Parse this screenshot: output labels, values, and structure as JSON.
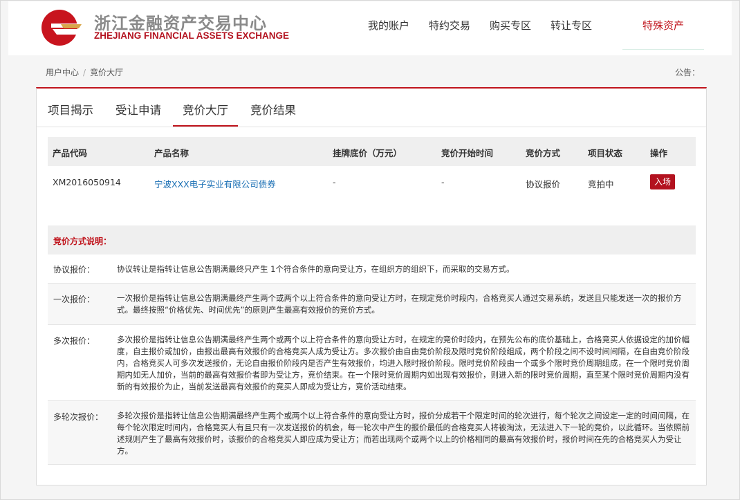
{
  "header": {
    "logo_cn": "浙江金融资产交易中心",
    "logo_en": "ZHEJIANG FINANCIAL ASSETS EXCHANGE",
    "nav": [
      "我的账户",
      "特约交易",
      "购买专区",
      "转让专区"
    ],
    "nav_special": "特殊资产"
  },
  "breadcrumb": {
    "home": "用户中心",
    "sep": "/",
    "current": "竞价大厅"
  },
  "notice": "公告：",
  "tabs": [
    "项目揭示",
    "受让申请",
    "竞价大厅",
    "竞价结果"
  ],
  "table": {
    "headers": [
      "产品代码",
      "产品名称",
      "挂牌底价（万元）",
      "竞价开始时间",
      "竞价方式",
      "项目状态",
      "操作"
    ],
    "row": {
      "code": "XM2016050914",
      "name": "宁波XXX电子实业有限公司债券",
      "price": "-",
      "start": "-",
      "method": "协议报价",
      "status": "竞拍中",
      "action": "入场"
    }
  },
  "desc_title": "竞价方式说明：",
  "descriptions": [
    {
      "label": "协议报价：",
      "text": "协议转让是指转让信息公告期满最终只产生 1个符合条件的意向受让方，在组织方的组织下，而采取的交易方式。"
    },
    {
      "label": "一次报价：",
      "text": "一次报价是指转让信息公告期满最终产生两个或两个以上符合条件的意向受让方时，在规定竞价时段内，合格竞买人通过交易系统，发送且只能发送一次的报价方式。最终按照“价格优先、时间优先”的原则产生最高有效报价的竞价方式。"
    },
    {
      "label": "多次报价：",
      "text": "多次报价是指转让信息公告期满最终产生两个或两个以上符合条件的意向受让方时，在规定的竞价时段内，在预先公布的底价基础上，合格竞买人依据设定的加价幅度，自主报价或加价，由报出最高有效报价的合格竞买人成为受让方。多次报价由自由竞价阶段及限时竞价阶段组成，两个阶段之间不设时间间隔，在自由竞价阶段内，合格竞买人可多次发送报价，无论自由报价阶段内是否产生有效报价，均进入限时报价阶段。限时竞价阶段由一个或多个限时竞价周期组成，在一个限时竞价周期内如无人加价，当前的最高有效报价者即为受让方，竞价结束。在一个限时竞价周期内如出现有效报价，则进入新的限时竞价周期，直至某个限时竞价周期内没有新的有效报价为止，当前发送最高有效报价的竞买人即成为受让方，竞价活动结束。"
    },
    {
      "label": "多轮次报价：",
      "text": "多轮次报价是指转让信息公告期满最终产生两个或两个以上符合条件的意向受让方时，报价分成若干个限定时间的轮次进行，每个轮次之间设定一定的时间间隔，在每个轮次限定时间内，合格竞买人有且只有一次发送报价的机会，每一轮次中产生的报价最低的合格竞买人将被淘汰，无法进入下一轮的竞价，以此循环。当依照前述规则产生了最高有效报价时，该报价的合格竞买人即应成为受让方；而若出现两个或两个以上的价格相同的最高有效报价时，报价时间在先的合格竞买人为受让方。"
    }
  ],
  "colors": {
    "brand_red": "#c0141c",
    "link_blue": "#1a6fb4"
  }
}
